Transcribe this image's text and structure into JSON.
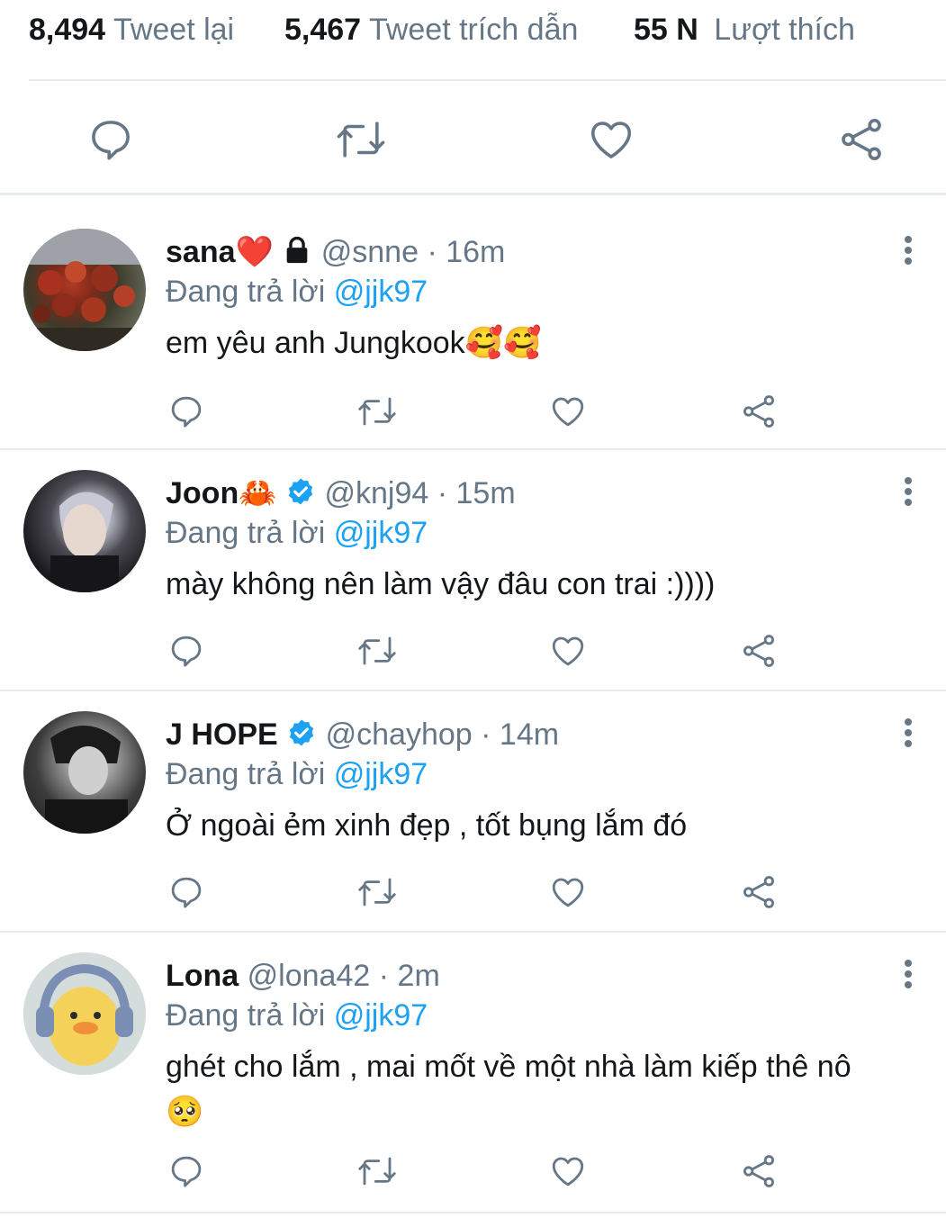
{
  "stats": {
    "retweets_count": "8,494",
    "retweets_label": "Tweet lại",
    "quotes_count": "5,467",
    "quotes_label": "Tweet trích dẫn",
    "likes_count": "55 N",
    "likes_label": "Lượt thích"
  },
  "replies": [
    {
      "name": "sana",
      "name_suffix": "❤️",
      "handle": "@snne",
      "sep": "·",
      "time": "16m",
      "replying_label": "Đang trả lời",
      "replying_to": "@jjk97",
      "text": "em yêu anh Jungkook🥰🥰",
      "locked": true,
      "verified": false
    },
    {
      "name": "Joon",
      "name_suffix": "🦀",
      "handle": "@knj94",
      "sep": "·",
      "time": "15m",
      "replying_label": "Đang trả lời",
      "replying_to": "@jjk97",
      "text": "mày không nên làm vậy đâu con trai :))))",
      "locked": false,
      "verified": true
    },
    {
      "name": "J HOPE",
      "name_suffix": "",
      "handle": "@chayhop",
      "sep": "·",
      "time": "14m",
      "replying_label": "Đang trả lời",
      "replying_to": "@jjk97",
      "text": "Ở ngoài ẻm xinh đẹp , tốt bụng lắm đó",
      "locked": false,
      "verified": true
    },
    {
      "name": "Lona",
      "name_suffix": "",
      "handle": "@lona42",
      "sep": "·",
      "time": "2m",
      "replying_label": "Đang trả lời",
      "replying_to": "@jjk97",
      "text": "ghét cho lắm , mai mốt về một nhà làm kiếp thê nô",
      "text_emoji": "🥺",
      "locked": false,
      "verified": false
    }
  ],
  "icons": {
    "reply": "reply-icon",
    "retweet": "retweet-icon",
    "like": "heart-icon",
    "share": "share-icon",
    "more": "more-options-icon",
    "verified": "verified-badge-icon",
    "lock": "lock-icon"
  },
  "colors": {
    "accent": "#1da1f2",
    "muted": "#657786",
    "divider": "#e6ecf0",
    "text": "#14171a"
  }
}
